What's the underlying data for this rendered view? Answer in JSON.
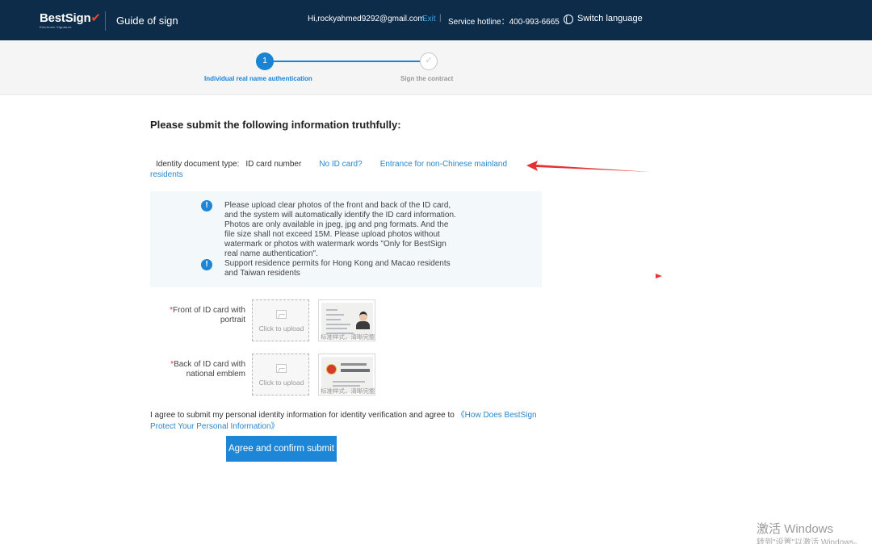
{
  "header": {
    "logo": "BestSign",
    "logo_sub": "Electronic Signature",
    "title": "Guide of sign",
    "user": "Hi,rockyahmed9292@gmail.com",
    "exit": "Exit",
    "separator": "|",
    "hotline": "Service hotline：400-993-6665",
    "switch_language": "Switch language"
  },
  "steps": {
    "step1_number": "1",
    "step1_label": "Individual real name authentication",
    "step2_icon": "✓",
    "step2_label": "Sign the contract"
  },
  "main": {
    "title": "Please submit the following information truthfully:",
    "doc_type_label": "Identity document type:",
    "doc_type_value": "ID card number",
    "no_id_link": "No ID card?",
    "entrance_link": "Entrance for non-Chinese mainland residents"
  },
  "notice": {
    "text1": "Please upload clear photos of the front and back of the ID card, and the system will automatically identify the ID card information. Photos are only available in jpeg, jpg and png formats. And the file size shall not exceed 15M. Please upload photos without watermark or photos with watermark words \"Only for BestSign real name authentication\".",
    "text2": "Support residence permits for Hong Kong and Macao residents and Taiwan residents"
  },
  "uploads": {
    "required_mark": "*",
    "front_label": "Front of ID card with portrait",
    "back_label": "Back of ID card with national emblem",
    "upload_text": "Click to upload",
    "watermark": "标准样式，清晰完整"
  },
  "agreement": {
    "text": "I agree to submit my personal identity information for identity verification and agree to",
    "link": "《How Does BestSign Protect Your Personal Information》",
    "button": "Agree and confirm submit"
  },
  "windows": {
    "activate": "激活 Windows",
    "activate_sub": "转到\"设置\"以激活 Windows。"
  },
  "colors": {
    "header_bg": "#0d2c4a",
    "accent": "#1d86d6",
    "link": "#2a86c9",
    "annotation_arrow": "#e33333"
  }
}
